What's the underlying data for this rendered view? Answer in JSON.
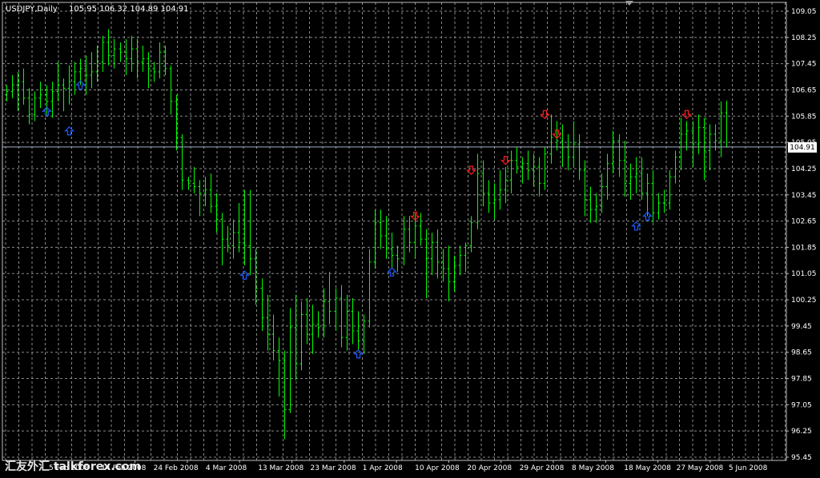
{
  "header": {
    "symbol_label": "USDJPY,Daily",
    "ohlc_label": "105.95 106.32 104.89 104.91"
  },
  "watermark": "汇友外汇 talkforex.com",
  "current_price_label": "104.91",
  "colors": {
    "background": "#000000",
    "frame": "#c0c0c0",
    "grid": "#8a8a8a",
    "bar": "#00ff00",
    "buy_arrow": "#1e5bff",
    "sell_arrow": "#ff1e1e",
    "price_line": "#9fb0c2",
    "text": "#ffffff"
  },
  "chart_data": {
    "type": "ohlc",
    "title": "USDJPY,Daily",
    "y_tick_labels": [
      "109.05",
      "108.25",
      "107.45",
      "106.65",
      "105.85",
      "105.05",
      "104.25",
      "103.45",
      "102.65",
      "101.85",
      "101.05",
      "100.25",
      "99.45",
      "98.65",
      "97.85",
      "97.05",
      "96.25",
      "95.45"
    ],
    "ylim": [
      95.45,
      109.05
    ],
    "x_tick_labels": [
      "5 Feb 2008",
      "14 Feb 2008",
      "24 Feb 2008",
      "4 Mar 2008",
      "13 Mar 2008",
      "23 Mar 2008",
      "1 Apr 2008",
      "10 Apr 2008",
      "20 Apr 2008",
      "29 Apr 2008",
      "8 May 2008",
      "18 May 2008",
      "27 May 2008",
      "5 Jun 2008"
    ],
    "grid": true,
    "current_price": 104.91,
    "series": [
      {
        "bars": [
          {
            "o": 106.5,
            "h": 106.8,
            "l": 106.3,
            "c": 106.6
          },
          {
            "o": 106.6,
            "h": 107.1,
            "l": 106.4,
            "c": 106.8
          },
          {
            "o": 106.8,
            "h": 107.2,
            "l": 106.0,
            "c": 106.9
          },
          {
            "o": 106.9,
            "h": 107.3,
            "l": 106.2,
            "c": 106.4
          },
          {
            "o": 106.4,
            "h": 106.7,
            "l": 105.6,
            "c": 105.9
          },
          {
            "o": 105.9,
            "h": 106.6,
            "l": 105.7,
            "c": 106.4
          },
          {
            "o": 106.4,
            "h": 106.9,
            "l": 106.1,
            "c": 106.5
          },
          {
            "o": 106.5,
            "h": 106.8,
            "l": 105.9,
            "c": 106.3
          },
          {
            "o": 106.3,
            "h": 106.9,
            "l": 105.8,
            "c": 106.6
          },
          {
            "o": 106.6,
            "h": 107.5,
            "l": 106.3,
            "c": 106.8
          },
          {
            "o": 106.8,
            "h": 107.0,
            "l": 106.0,
            "c": 106.7
          },
          {
            "o": 106.7,
            "h": 107.4,
            "l": 106.2,
            "c": 106.9
          },
          {
            "o": 106.9,
            "h": 107.5,
            "l": 106.5,
            "c": 107.2
          },
          {
            "o": 107.2,
            "h": 107.6,
            "l": 106.8,
            "c": 107.3
          },
          {
            "o": 107.3,
            "h": 107.7,
            "l": 106.5,
            "c": 107.1
          },
          {
            "o": 107.1,
            "h": 107.8,
            "l": 106.7,
            "c": 107.2
          },
          {
            "o": 107.2,
            "h": 108.0,
            "l": 106.9,
            "c": 107.5
          },
          {
            "o": 107.5,
            "h": 108.3,
            "l": 107.2,
            "c": 108.1
          },
          {
            "o": 108.1,
            "h": 108.5,
            "l": 107.4,
            "c": 107.7
          },
          {
            "o": 107.7,
            "h": 108.2,
            "l": 107.3,
            "c": 107.9
          },
          {
            "o": 107.9,
            "h": 108.1,
            "l": 107.5,
            "c": 107.8
          },
          {
            "o": 107.8,
            "h": 108.2,
            "l": 107.1,
            "c": 107.6
          },
          {
            "o": 107.6,
            "h": 108.3,
            "l": 107.2,
            "c": 107.9
          },
          {
            "o": 107.9,
            "h": 108.2,
            "l": 107.0,
            "c": 107.5
          },
          {
            "o": 107.5,
            "h": 108.0,
            "l": 107.2,
            "c": 107.6
          },
          {
            "o": 107.6,
            "h": 107.8,
            "l": 106.7,
            "c": 107.3
          },
          {
            "o": 107.3,
            "h": 107.5,
            "l": 106.9,
            "c": 107.2
          },
          {
            "o": 107.2,
            "h": 108.1,
            "l": 107.0,
            "c": 107.8
          },
          {
            "o": 107.8,
            "h": 108.0,
            "l": 107.1,
            "c": 107.3
          },
          {
            "o": 107.3,
            "h": 107.4,
            "l": 105.9,
            "c": 106.3
          },
          {
            "o": 106.3,
            "h": 106.5,
            "l": 104.8,
            "c": 105.2
          },
          {
            "o": 105.2,
            "h": 105.3,
            "l": 103.6,
            "c": 103.9
          },
          {
            "o": 103.9,
            "h": 104.0,
            "l": 103.6,
            "c": 103.8
          },
          {
            "o": 103.8,
            "h": 104.3,
            "l": 103.5,
            "c": 103.7
          },
          {
            "o": 103.7,
            "h": 103.9,
            "l": 102.8,
            "c": 103.5
          },
          {
            "o": 103.5,
            "h": 104.0,
            "l": 103.1,
            "c": 103.6
          },
          {
            "o": 103.6,
            "h": 104.1,
            "l": 102.9,
            "c": 103.1
          },
          {
            "o": 103.1,
            "h": 103.5,
            "l": 102.3,
            "c": 102.7
          },
          {
            "o": 102.7,
            "h": 102.9,
            "l": 101.3,
            "c": 102.1
          },
          {
            "o": 102.1,
            "h": 102.5,
            "l": 101.7,
            "c": 101.9
          },
          {
            "o": 101.9,
            "h": 102.7,
            "l": 101.5,
            "c": 102.3
          },
          {
            "o": 102.3,
            "h": 103.2,
            "l": 101.7,
            "c": 102.0
          },
          {
            "o": 102.0,
            "h": 103.6,
            "l": 101.3,
            "c": 101.9
          },
          {
            "o": 101.9,
            "h": 103.6,
            "l": 101.0,
            "c": 101.5
          },
          {
            "o": 101.5,
            "h": 101.8,
            "l": 100.1,
            "c": 100.6
          },
          {
            "o": 100.6,
            "h": 100.9,
            "l": 99.3,
            "c": 99.7
          },
          {
            "o": 99.7,
            "h": 100.4,
            "l": 98.7,
            "c": 99.2
          },
          {
            "o": 99.2,
            "h": 99.8,
            "l": 98.4,
            "c": 98.7
          },
          {
            "o": 98.7,
            "h": 99.1,
            "l": 97.3,
            "c": 98.4
          },
          {
            "o": 98.4,
            "h": 98.7,
            "l": 96.0,
            "c": 96.9
          },
          {
            "o": 96.9,
            "h": 100.0,
            "l": 96.8,
            "c": 99.4
          },
          {
            "o": 99.4,
            "h": 100.4,
            "l": 97.8,
            "c": 98.3
          },
          {
            "o": 98.3,
            "h": 100.2,
            "l": 98.1,
            "c": 99.8
          },
          {
            "o": 99.8,
            "h": 100.3,
            "l": 98.9,
            "c": 99.2
          },
          {
            "o": 99.2,
            "h": 100.1,
            "l": 98.6,
            "c": 99.5
          },
          {
            "o": 99.5,
            "h": 99.9,
            "l": 99.1,
            "c": 99.4
          },
          {
            "o": 99.4,
            "h": 100.6,
            "l": 99.1,
            "c": 100.2
          },
          {
            "o": 100.2,
            "h": 101.1,
            "l": 99.5,
            "c": 99.9
          },
          {
            "o": 99.9,
            "h": 100.6,
            "l": 99.3,
            "c": 100.3
          },
          {
            "o": 100.3,
            "h": 100.7,
            "l": 98.8,
            "c": 99.1
          },
          {
            "o": 99.1,
            "h": 100.4,
            "l": 98.7,
            "c": 99.9
          },
          {
            "o": 99.9,
            "h": 100.3,
            "l": 98.9,
            "c": 99.3
          },
          {
            "o": 99.3,
            "h": 99.9,
            "l": 98.7,
            "c": 99.0
          },
          {
            "o": 99.0,
            "h": 99.8,
            "l": 98.6,
            "c": 99.6
          },
          {
            "o": 99.6,
            "h": 101.8,
            "l": 99.4,
            "c": 101.4
          },
          {
            "o": 101.4,
            "h": 103.0,
            "l": 101.2,
            "c": 102.6
          },
          {
            "o": 102.6,
            "h": 103.0,
            "l": 101.8,
            "c": 102.2
          },
          {
            "o": 102.2,
            "h": 102.8,
            "l": 101.5,
            "c": 101.8
          },
          {
            "o": 101.8,
            "h": 102.3,
            "l": 101.2,
            "c": 101.6
          },
          {
            "o": 101.6,
            "h": 101.9,
            "l": 101.1,
            "c": 101.5
          },
          {
            "o": 101.5,
            "h": 102.8,
            "l": 101.3,
            "c": 102.4
          },
          {
            "o": 102.4,
            "h": 102.8,
            "l": 101.7,
            "c": 102.0
          },
          {
            "o": 102.0,
            "h": 102.9,
            "l": 101.5,
            "c": 102.5
          },
          {
            "o": 102.5,
            "h": 102.9,
            "l": 101.9,
            "c": 102.1
          },
          {
            "o": 102.1,
            "h": 102.4,
            "l": 100.3,
            "c": 101.5
          },
          {
            "o": 101.5,
            "h": 102.3,
            "l": 101.0,
            "c": 102.0
          },
          {
            "o": 102.0,
            "h": 102.4,
            "l": 100.9,
            "c": 101.4
          },
          {
            "o": 101.4,
            "h": 101.8,
            "l": 100.8,
            "c": 101.2
          },
          {
            "o": 101.2,
            "h": 101.9,
            "l": 100.2,
            "c": 100.8
          },
          {
            "o": 100.8,
            "h": 101.6,
            "l": 100.5,
            "c": 101.3
          },
          {
            "o": 101.3,
            "h": 101.9,
            "l": 101.0,
            "c": 101.6
          },
          {
            "o": 101.6,
            "h": 102.0,
            "l": 101.1,
            "c": 101.9
          },
          {
            "o": 101.9,
            "h": 102.8,
            "l": 101.7,
            "c": 102.6
          },
          {
            "o": 102.6,
            "h": 104.7,
            "l": 102.4,
            "c": 104.1
          },
          {
            "o": 104.1,
            "h": 104.5,
            "l": 103.1,
            "c": 103.5
          },
          {
            "o": 103.5,
            "h": 103.9,
            "l": 102.9,
            "c": 103.2
          },
          {
            "o": 103.2,
            "h": 103.8,
            "l": 102.7,
            "c": 103.3
          },
          {
            "o": 103.3,
            "h": 104.2,
            "l": 103.0,
            "c": 103.6
          },
          {
            "o": 103.6,
            "h": 104.3,
            "l": 103.2,
            "c": 103.9
          },
          {
            "o": 103.9,
            "h": 104.8,
            "l": 103.5,
            "c": 104.5
          },
          {
            "o": 104.5,
            "h": 104.9,
            "l": 104.1,
            "c": 104.3
          },
          {
            "o": 104.3,
            "h": 104.6,
            "l": 103.8,
            "c": 104.4
          },
          {
            "o": 104.4,
            "h": 104.8,
            "l": 103.9,
            "c": 104.2
          },
          {
            "o": 104.2,
            "h": 104.7,
            "l": 103.7,
            "c": 104.3
          },
          {
            "o": 104.3,
            "h": 104.6,
            "l": 103.4,
            "c": 103.8
          },
          {
            "o": 103.8,
            "h": 104.9,
            "l": 103.6,
            "c": 104.7
          },
          {
            "o": 104.7,
            "h": 105.9,
            "l": 104.4,
            "c": 105.2
          },
          {
            "o": 105.2,
            "h": 105.7,
            "l": 104.8,
            "c": 105.1
          },
          {
            "o": 105.1,
            "h": 105.6,
            "l": 104.3,
            "c": 104.9
          },
          {
            "o": 104.9,
            "h": 105.3,
            "l": 104.2,
            "c": 104.6
          },
          {
            "o": 104.6,
            "h": 105.7,
            "l": 104.3,
            "c": 105.0
          },
          {
            "o": 105.0,
            "h": 105.3,
            "l": 103.9,
            "c": 104.2
          },
          {
            "o": 104.2,
            "h": 104.5,
            "l": 102.8,
            "c": 103.3
          },
          {
            "o": 103.3,
            "h": 103.7,
            "l": 102.6,
            "c": 103.0
          },
          {
            "o": 103.0,
            "h": 103.5,
            "l": 102.6,
            "c": 103.1
          },
          {
            "o": 103.1,
            "h": 104.1,
            "l": 102.9,
            "c": 103.7
          },
          {
            "o": 103.7,
            "h": 104.7,
            "l": 103.3,
            "c": 104.4
          },
          {
            "o": 104.4,
            "h": 105.4,
            "l": 104.1,
            "c": 105.1
          },
          {
            "o": 105.1,
            "h": 105.3,
            "l": 104.0,
            "c": 104.5
          },
          {
            "o": 104.5,
            "h": 105.1,
            "l": 103.4,
            "c": 103.8
          },
          {
            "o": 103.8,
            "h": 104.4,
            "l": 103.3,
            "c": 104.0
          },
          {
            "o": 104.0,
            "h": 104.6,
            "l": 103.5,
            "c": 104.1
          },
          {
            "o": 104.1,
            "h": 104.6,
            "l": 103.3,
            "c": 103.5
          },
          {
            "o": 103.5,
            "h": 104.1,
            "l": 102.8,
            "c": 103.8
          },
          {
            "o": 103.8,
            "h": 104.2,
            "l": 102.6,
            "c": 102.9
          },
          {
            "o": 102.9,
            "h": 103.5,
            "l": 102.7,
            "c": 103.2
          },
          {
            "o": 103.2,
            "h": 103.6,
            "l": 102.9,
            "c": 103.2
          },
          {
            "o": 103.2,
            "h": 104.2,
            "l": 103.0,
            "c": 104.0
          },
          {
            "o": 104.0,
            "h": 104.8,
            "l": 103.8,
            "c": 104.6
          },
          {
            "o": 104.6,
            "h": 105.8,
            "l": 104.2,
            "c": 105.3
          },
          {
            "o": 105.3,
            "h": 105.7,
            "l": 104.8,
            "c": 105.4
          },
          {
            "o": 105.4,
            "h": 105.7,
            "l": 104.3,
            "c": 105.0
          },
          {
            "o": 105.0,
            "h": 105.9,
            "l": 104.7,
            "c": 105.5
          },
          {
            "o": 105.5,
            "h": 105.8,
            "l": 103.9,
            "c": 104.8
          },
          {
            "o": 104.8,
            "h": 105.6,
            "l": 104.2,
            "c": 105.3
          },
          {
            "o": 105.3,
            "h": 105.6,
            "l": 104.8,
            "c": 105.1
          },
          {
            "o": 105.1,
            "h": 106.3,
            "l": 104.6,
            "c": 105.95
          },
          {
            "o": 105.95,
            "h": 106.32,
            "l": 104.89,
            "c": 104.91
          }
        ]
      }
    ],
    "signals": [
      {
        "bar": 7,
        "type": "buy",
        "price": 106.0
      },
      {
        "bar": 11,
        "type": "buy",
        "price": 105.4
      },
      {
        "bar": 13,
        "type": "buy",
        "price": 106.8
      },
      {
        "bar": 42,
        "type": "buy",
        "price": 101.0
      },
      {
        "bar": 62,
        "type": "buy",
        "price": 98.6
      },
      {
        "bar": 68,
        "type": "buy",
        "price": 101.1
      },
      {
        "bar": 72,
        "type": "sell",
        "price": 102.8
      },
      {
        "bar": 82,
        "type": "sell",
        "price": 104.2
      },
      {
        "bar": 88,
        "type": "sell",
        "price": 104.5
      },
      {
        "bar": 95,
        "type": "sell",
        "price": 105.9
      },
      {
        "bar": 97,
        "type": "sell",
        "price": 105.3
      },
      {
        "bar": 111,
        "type": "buy",
        "price": 102.5
      },
      {
        "bar": 113,
        "type": "buy",
        "price": 102.8
      },
      {
        "bar": 120,
        "type": "sell",
        "price": 105.9
      }
    ]
  }
}
